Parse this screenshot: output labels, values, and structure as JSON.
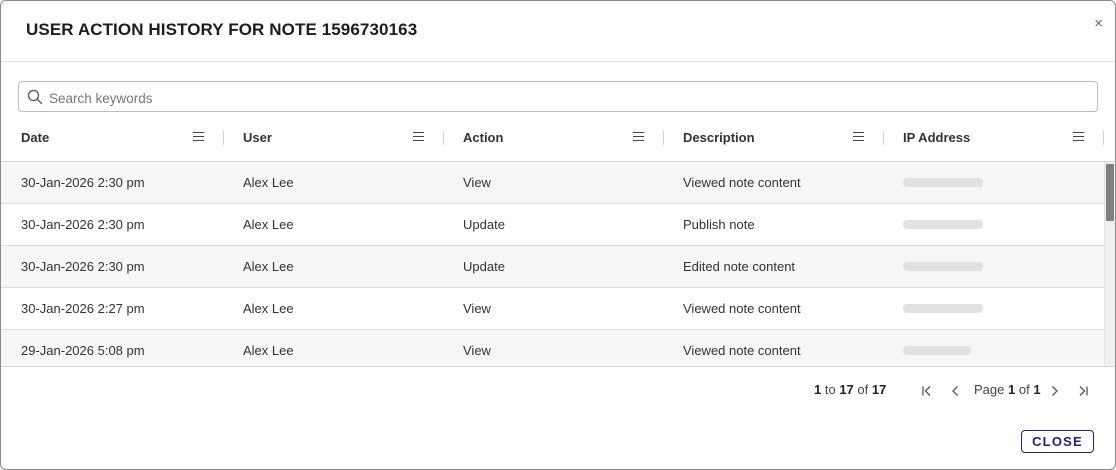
{
  "dialog": {
    "title": "USER ACTION HISTORY FOR NOTE 1596730163",
    "close_icon": "×"
  },
  "search": {
    "placeholder": "Search keywords",
    "value": ""
  },
  "table": {
    "columns": [
      "Date",
      "User",
      "Action",
      "Description",
      "IP Address"
    ],
    "rows": [
      {
        "date": "30-Jan-2026 2:30 pm",
        "user": "Alex Lee",
        "action": "View",
        "description": "Viewed note content",
        "ip": ""
      },
      {
        "date": "30-Jan-2026 2:30 pm",
        "user": "Alex Lee",
        "action": "Update",
        "description": "Publish note",
        "ip": ""
      },
      {
        "date": "30-Jan-2026 2:30 pm",
        "user": "Alex Lee",
        "action": "Update",
        "description": "Edited note content",
        "ip": ""
      },
      {
        "date": "30-Jan-2026 2:27 pm",
        "user": "Alex Lee",
        "action": "View",
        "description": "Viewed note content",
        "ip": ""
      },
      {
        "date": "29-Jan-2026 5:08 pm",
        "user": "Alex Lee",
        "action": "View",
        "description": "Viewed note content",
        "ip": ""
      }
    ]
  },
  "pagination": {
    "from": "1",
    "to_word": "to",
    "to": "17",
    "of_word": "of",
    "total": "17",
    "page_word": "Page",
    "page": "1",
    "page_of_word": "of",
    "page_total": "1"
  },
  "footer": {
    "close_label": "CLOSE"
  },
  "colors": {
    "accent": "#24216f",
    "row_alt": "#f5f6f8",
    "scroll_thumb": "#7f7f7f"
  }
}
